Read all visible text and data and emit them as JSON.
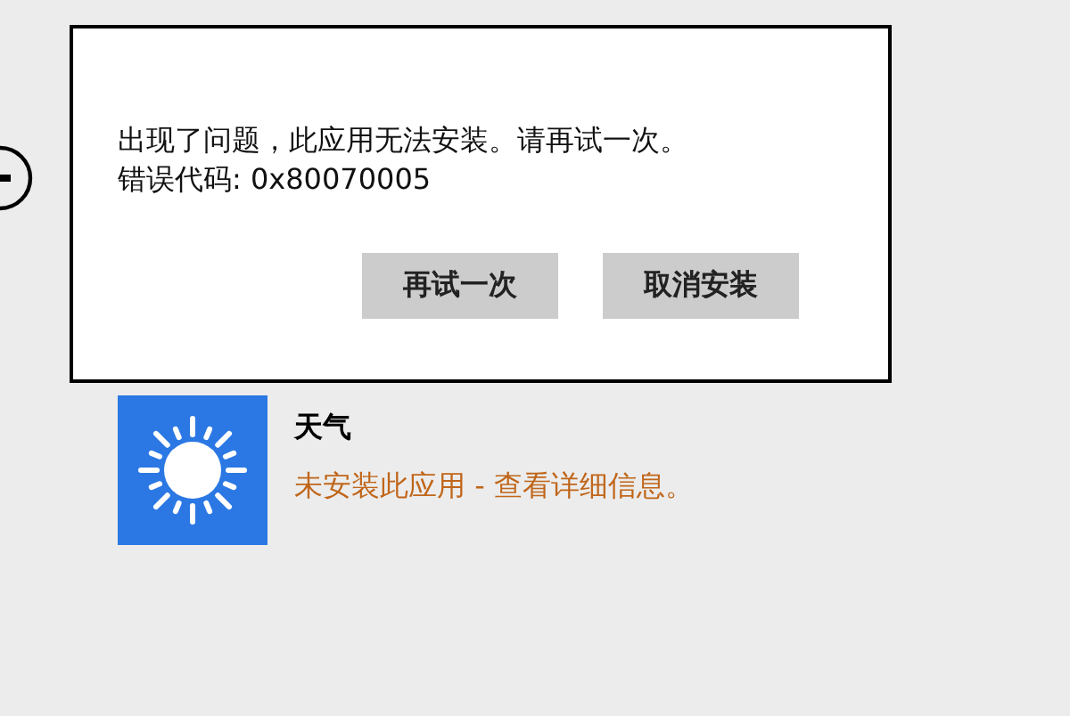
{
  "dialog": {
    "message_lines": [
      "出现了问题，此应用无法安装。请再试一次。",
      "错误代码: 0x80070005"
    ],
    "buttons": [
      {
        "label": "再试一次"
      },
      {
        "label": "取消安装"
      }
    ]
  },
  "app": {
    "name": "天气",
    "status_link": "未安装此应用 - 查看详细信息。"
  }
}
